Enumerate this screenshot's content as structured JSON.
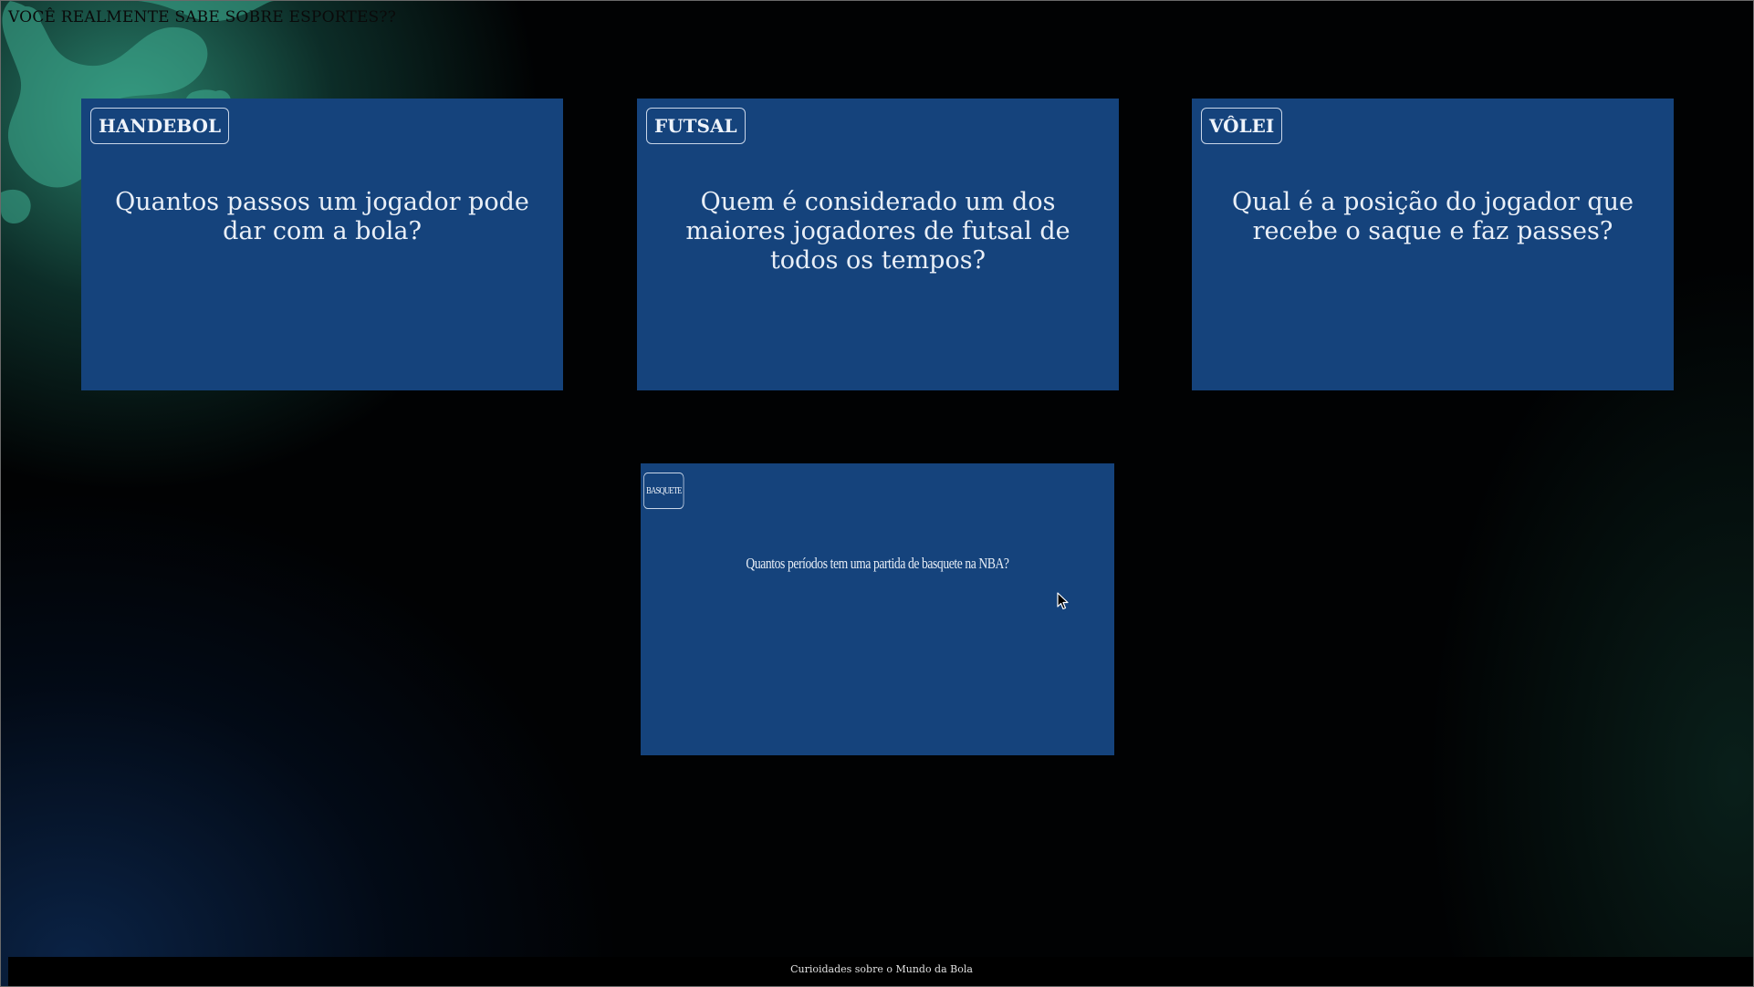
{
  "page": {
    "title": "VOCÊ REALMENTE SABE SOBRE ESPORTES??"
  },
  "cards": [
    {
      "sport": "HANDEBOL",
      "question": "Quantos passos um jogador pode dar com a bola?"
    },
    {
      "sport": "FUTSAL",
      "question": "Quem é considerado um dos maiores jogadores de futsal de todos os tempos?"
    },
    {
      "sport": "VÔLEI",
      "question": "Qual é a posição do jogador que recebe o saque e faz passes?"
    },
    {
      "sport": "BASQUETE",
      "question": "Quantos períodos tem uma partida de basquete na NBA?"
    }
  ],
  "footer": {
    "text": "Curioidades sobre o Mundo da Bola"
  },
  "colors": {
    "card_background": "#15437c",
    "accent_green": "#2f9a7c",
    "page_background": "#010203"
  },
  "icons": {
    "cursor": "mouse-pointer-icon"
  }
}
